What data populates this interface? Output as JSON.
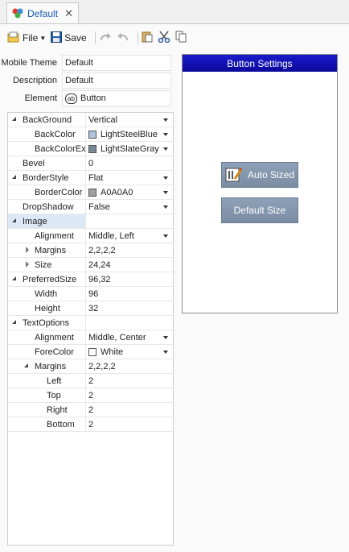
{
  "tab": {
    "title": "Default"
  },
  "toolbar": {
    "file_label": "File",
    "save_label": "Save"
  },
  "form": {
    "mobile_theme": {
      "label": "Mobile Theme",
      "value": "Default"
    },
    "description": {
      "label": "Description",
      "value": "Default"
    },
    "element": {
      "label": "Element",
      "value": "Button",
      "icon_text": "ab"
    }
  },
  "properties": [
    {
      "name": "BackGround",
      "value": "Vertical"
    },
    {
      "name": "BackColor",
      "value": "LightSteelBlue",
      "color": "#b0c4de"
    },
    {
      "name": "BackColorEx",
      "value": "LightSlateGray",
      "color": "#778899"
    },
    {
      "name": "Bevel",
      "value": "0"
    },
    {
      "name": "BorderStyle",
      "value": "Flat"
    },
    {
      "name": "BorderColor",
      "value": "A0A0A0",
      "color": "#a0a0a0"
    },
    {
      "name": "DropShadow",
      "value": "False"
    },
    {
      "name": "Image",
      "value": ""
    },
    {
      "name": "Alignment",
      "value": "Middle, Left"
    },
    {
      "name": "Margins",
      "value": "2,2,2,2"
    },
    {
      "name": "Size",
      "value": "24,24"
    },
    {
      "name": "PreferredSize",
      "value": "96,32"
    },
    {
      "name": "Width",
      "value": "96"
    },
    {
      "name": "Height",
      "value": "32"
    },
    {
      "name": "TextOptions",
      "value": ""
    },
    {
      "name": "Alignment",
      "value": "Middle, Center"
    },
    {
      "name": "ForeColor",
      "value": "White",
      "color": "#ffffff"
    },
    {
      "name": "Margins",
      "value": "2,2,2,2"
    },
    {
      "name": "Left",
      "value": "2"
    },
    {
      "name": "Top",
      "value": "2"
    },
    {
      "name": "Right",
      "value": "2"
    },
    {
      "name": "Bottom",
      "value": "2"
    }
  ],
  "preview": {
    "header": "Button Settings",
    "auto_sized_label": "Auto Sized",
    "default_size_label": "Default Size"
  },
  "colors": {
    "accent": "#1a5ab4",
    "header_blue": "#0a0a9a",
    "button_gray": "#7b8ca3"
  }
}
